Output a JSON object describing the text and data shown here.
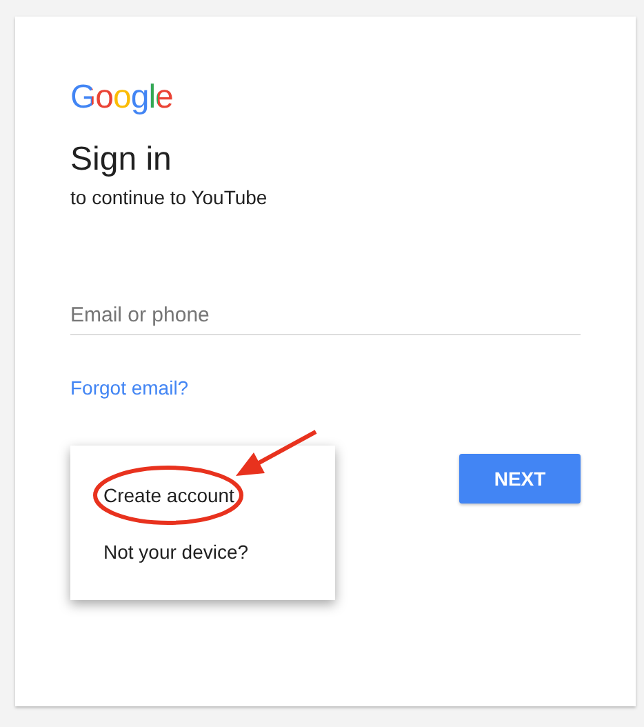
{
  "logo": "Google",
  "heading": "Sign in",
  "subheading": "to continue to YouTube",
  "email_field": {
    "placeholder": "Email or phone"
  },
  "forgot_link": "Forgot email?",
  "menu": {
    "items": [
      "Create account",
      "Not your device?"
    ]
  },
  "next_button": "NEXT"
}
